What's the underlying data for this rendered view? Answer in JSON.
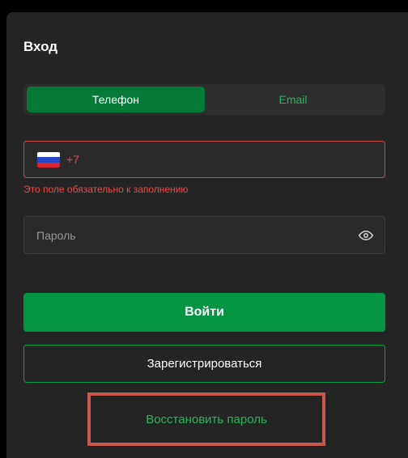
{
  "login": {
    "title": "Вход",
    "tabs": [
      {
        "label": "Телефон",
        "active": true
      },
      {
        "label": "Email",
        "active": false
      }
    ],
    "phone": {
      "country_flag": "russia-flag-icon",
      "placeholder": "+7",
      "value": "",
      "error": "Это поле обязательно к заполнению"
    },
    "password": {
      "placeholder": "Пароль",
      "value": "",
      "icon": "eye-icon"
    },
    "submit_label": "Войти",
    "register_label": "Зарегистрироваться",
    "recover_label": "Восстановить пароль"
  },
  "colors": {
    "accent_green": "#049442",
    "tab_active": "#037a36",
    "error_red": "#e84a4a",
    "panel": "#242424",
    "highlight_box": "#c9574c"
  }
}
